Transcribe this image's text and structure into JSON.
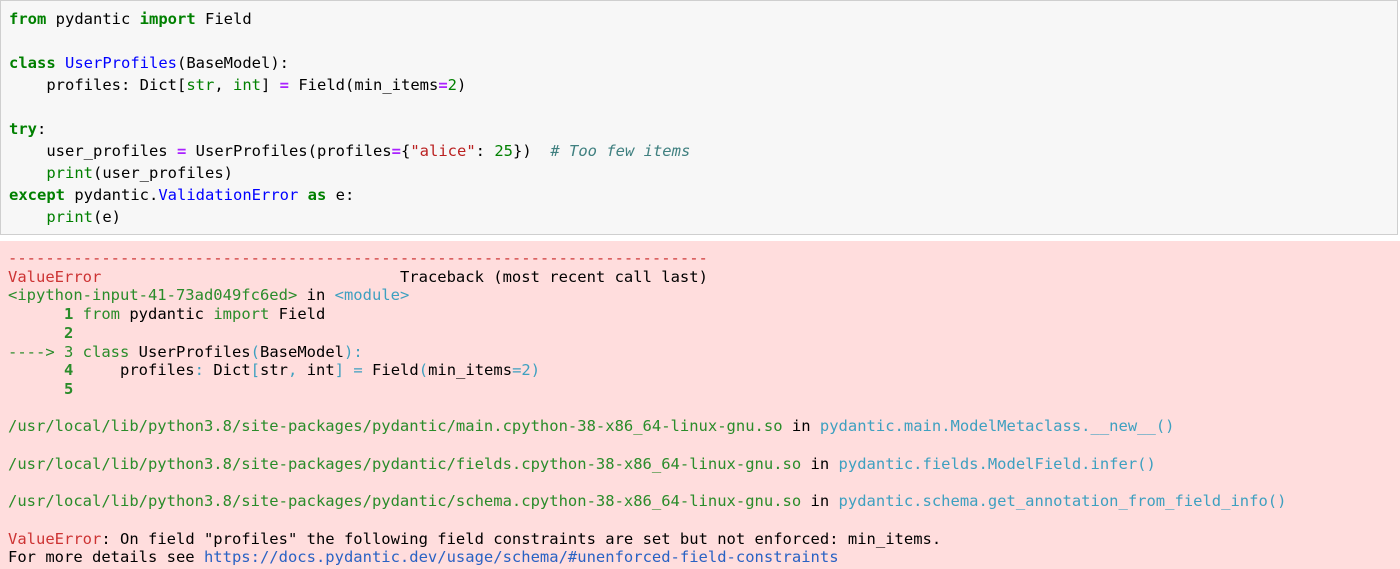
{
  "input_cell": {
    "lines": [
      [
        {
          "t": "from",
          "c": "kw"
        },
        {
          "t": " pydantic ",
          "c": ""
        },
        {
          "t": "import",
          "c": "kw"
        },
        {
          "t": " Field",
          "c": ""
        }
      ],
      [],
      [
        {
          "t": "class",
          "c": "kw"
        },
        {
          "t": " ",
          "c": ""
        },
        {
          "t": "UserProfiles",
          "c": "cls"
        },
        {
          "t": "(BaseModel):",
          "c": ""
        }
      ],
      [
        {
          "t": "    profiles: Dict[",
          "c": ""
        },
        {
          "t": "str",
          "c": "bi"
        },
        {
          "t": ", ",
          "c": ""
        },
        {
          "t": "int",
          "c": "bi"
        },
        {
          "t": "] ",
          "c": ""
        },
        {
          "t": "=",
          "c": "op"
        },
        {
          "t": " Field(min_items",
          "c": ""
        },
        {
          "t": "=",
          "c": "op"
        },
        {
          "t": "2",
          "c": "num"
        },
        {
          "t": ")",
          "c": ""
        }
      ],
      [],
      [
        {
          "t": "try",
          "c": "kw"
        },
        {
          "t": ":",
          "c": ""
        }
      ],
      [
        {
          "t": "    user_profiles ",
          "c": ""
        },
        {
          "t": "=",
          "c": "op"
        },
        {
          "t": " UserProfiles(profiles",
          "c": ""
        },
        {
          "t": "=",
          "c": "op"
        },
        {
          "t": "{",
          "c": ""
        },
        {
          "t": "\"alice\"",
          "c": "str"
        },
        {
          "t": ": ",
          "c": ""
        },
        {
          "t": "25",
          "c": "num"
        },
        {
          "t": "})  ",
          "c": ""
        },
        {
          "t": "# Too few items",
          "c": "cmt"
        }
      ],
      [
        {
          "t": "    ",
          "c": ""
        },
        {
          "t": "print",
          "c": "bi"
        },
        {
          "t": "(user_profiles)",
          "c": ""
        }
      ],
      [
        {
          "t": "except",
          "c": "kw"
        },
        {
          "t": " pydantic",
          "c": ""
        },
        {
          "t": ".",
          "c": ""
        },
        {
          "t": "ValidationError",
          "c": "cls"
        },
        {
          "t": " ",
          "c": ""
        },
        {
          "t": "as",
          "c": "kw"
        },
        {
          "t": " e:",
          "c": ""
        }
      ],
      [
        {
          "t": "    ",
          "c": ""
        },
        {
          "t": "print",
          "c": "bi"
        },
        {
          "t": "(e)",
          "c": ""
        }
      ]
    ]
  },
  "output_cell": {
    "lines": [
      [
        {
          "t": "---------------------------------------------------------------------------",
          "c": "red"
        }
      ],
      [
        {
          "t": "ValueError",
          "c": "red"
        },
        {
          "t": "                                Traceback (most recent call last)",
          "c": ""
        }
      ],
      [
        {
          "t": "<ipython-input-41-73ad049fc6ed>",
          "c": "grn"
        },
        {
          "t": " in ",
          "c": ""
        },
        {
          "t": "<module>",
          "c": "cyn"
        }
      ],
      [
        {
          "t": "      1",
          "c": "grnb"
        },
        {
          "t": " from",
          "c": "grn"
        },
        {
          "t": " pydantic ",
          "c": ""
        },
        {
          "t": "import",
          "c": "grn"
        },
        {
          "t": " Field",
          "c": ""
        }
      ],
      [
        {
          "t": "      2",
          "c": "grnb"
        }
      ],
      [
        {
          "t": "----> 3",
          "c": "grn"
        },
        {
          "t": " class",
          "c": "grn"
        },
        {
          "t": " UserProfiles",
          "c": ""
        },
        {
          "t": "(",
          "c": "cyn"
        },
        {
          "t": "BaseModel",
          "c": ""
        },
        {
          "t": "):",
          "c": "cyn"
        }
      ],
      [
        {
          "t": "      4",
          "c": "grnb"
        },
        {
          "t": "     profiles",
          "c": ""
        },
        {
          "t": ":",
          "c": "cyn"
        },
        {
          "t": " Dict",
          "c": ""
        },
        {
          "t": "[",
          "c": "cyn"
        },
        {
          "t": "str",
          "c": ""
        },
        {
          "t": ",",
          "c": "cyn"
        },
        {
          "t": " int",
          "c": ""
        },
        {
          "t": "]",
          "c": "cyn"
        },
        {
          "t": " ",
          "c": ""
        },
        {
          "t": "=",
          "c": "cyn"
        },
        {
          "t": " Field",
          "c": ""
        },
        {
          "t": "(",
          "c": "cyn"
        },
        {
          "t": "min_items",
          "c": ""
        },
        {
          "t": "=2)",
          "c": "cyn"
        }
      ],
      [
        {
          "t": "      5",
          "c": "grnb"
        }
      ],
      [],
      [
        {
          "t": "/usr/local/lib/python3.8/site-packages/pydantic/main.cpython-38-x86_64-linux-gnu.so",
          "c": "grn"
        },
        {
          "t": " in ",
          "c": ""
        },
        {
          "t": "pydantic.main.ModelMetaclass.__new__()",
          "c": "cyn"
        }
      ],
      [],
      [
        {
          "t": "/usr/local/lib/python3.8/site-packages/pydantic/fields.cpython-38-x86_64-linux-gnu.so",
          "c": "grn"
        },
        {
          "t": " in ",
          "c": ""
        },
        {
          "t": "pydantic.fields.ModelField.infer()",
          "c": "cyn"
        }
      ],
      [],
      [
        {
          "t": "/usr/local/lib/python3.8/site-packages/pydantic/schema.cpython-38-x86_64-linux-gnu.so",
          "c": "grn"
        },
        {
          "t": " in ",
          "c": ""
        },
        {
          "t": "pydantic.schema.get_annotation_from_field_info()",
          "c": "cyn"
        }
      ],
      [],
      [
        {
          "t": "ValueError",
          "c": "red"
        },
        {
          "t": ": On field \"profiles\" the following field constraints are set but not enforced: min_items.",
          "c": ""
        }
      ],
      [
        {
          "t": "For more details see ",
          "c": ""
        },
        {
          "t": "https://docs.pydantic.dev/usage/schema/#unenforced-field-constraints",
          "c": "blu"
        }
      ]
    ]
  }
}
